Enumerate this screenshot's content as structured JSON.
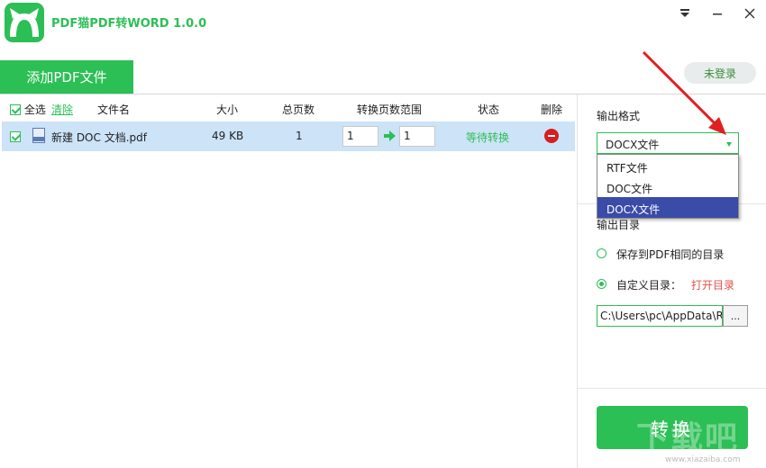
{
  "app": {
    "title": "PDF猫PDF转WORD 1.0.0",
    "brand_color": "#2cbf55"
  },
  "toolbar": {
    "add_button": "添加PDF文件",
    "login_button": "未登录"
  },
  "list": {
    "columns": {
      "select_all": "全选",
      "clear": "清除",
      "filename": "文件名",
      "size": "大小",
      "total_pages": "总页数",
      "page_range": "转换页数范围",
      "status": "状态",
      "delete": "删除"
    },
    "rows": [
      {
        "checked": true,
        "filename": "新建 DOC 文档.pdf",
        "size": "49 KB",
        "total_pages": "1",
        "range_from": "1",
        "range_to": "1",
        "status": "等待转换"
      }
    ]
  },
  "settings": {
    "format_label": "输出格式",
    "format_selected": "DOCX文件",
    "format_options": [
      "RTF文件",
      "DOC文件",
      "DOCX文件"
    ],
    "dir_label": "输出目录",
    "dir_option_same": "保存到PDF相同的目录",
    "dir_option_custom": "自定义目录：",
    "open_dir": "打开目录",
    "path": "C:\\Users\\pc\\AppData\\R",
    "browse_label": "...",
    "convert_button": "转换"
  },
  "watermark": {
    "text": "下载吧",
    "url": "www.xiazaiba.com"
  }
}
